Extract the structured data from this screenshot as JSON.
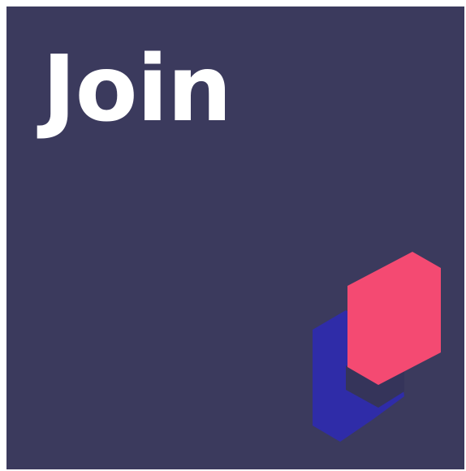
{
  "card": {
    "title": "Join",
    "background_color": "#3b3a5d",
    "title_color": "#ffffff"
  },
  "logo": {
    "icon": "stacked-hexagons-logo",
    "front_color": "#f44a72",
    "back_color": "#2f2ca8",
    "shadow_color": "#35345a"
  }
}
